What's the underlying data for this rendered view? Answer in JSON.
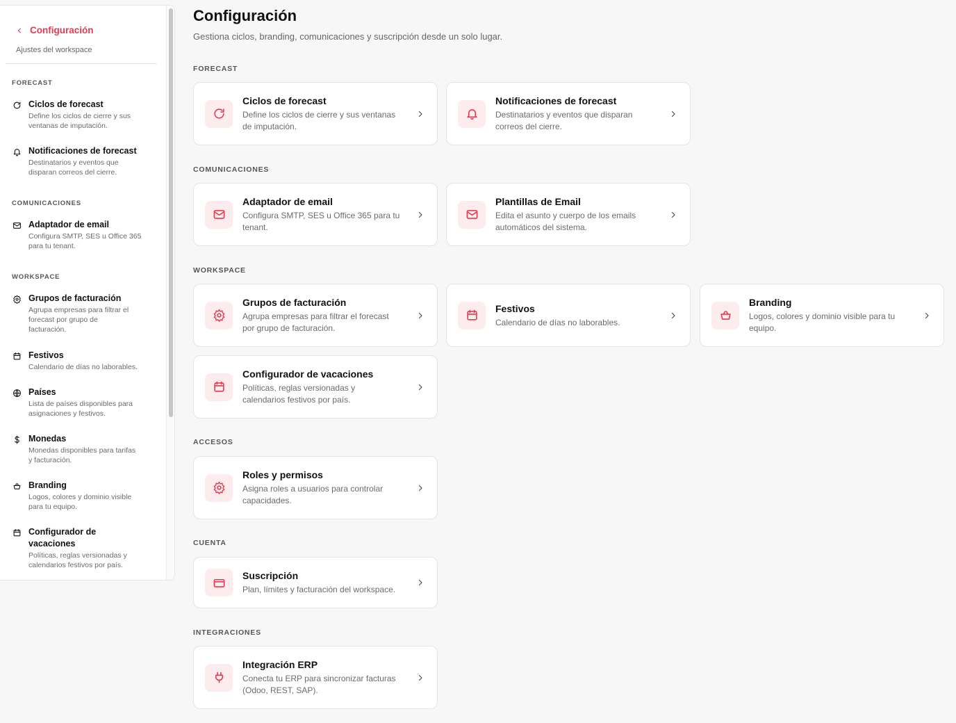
{
  "sidebar": {
    "back_label": "Configuración",
    "subtitle": "Ajustes del workspace",
    "sections": {
      "forecast": "FORECAST",
      "comunicaciones": "COMUNICACIONES",
      "workspace": "WORKSPACE"
    },
    "items": [
      {
        "icon": "refresh-icon",
        "title": "Ciclos de forecast",
        "desc_l1": "Define los ciclos de cierre y sus",
        "desc_l2": "ventanas de imputación."
      },
      {
        "icon": "bell-icon",
        "title": "Notificaciones de forecast",
        "desc_l1": "Destinatarios y eventos que",
        "desc_l2": "disparan correos del cierre."
      },
      {
        "icon": "mail-icon",
        "title": "Adaptador de email",
        "desc_l1": "Configura SMTP, SES u Office 365",
        "desc_l2": "para tu tenant."
      },
      {
        "icon": "gear-icon",
        "title": "Grupos de facturación",
        "desc_l1": "Agrupa empresas para filtrar el",
        "desc_l2": "forecast por grupo de",
        "desc_l3": "facturación."
      },
      {
        "icon": "calendar-icon",
        "title": "Festivos",
        "desc_l1": "Calendario de días no laborables."
      },
      {
        "icon": "globe-icon",
        "title": "Países",
        "desc_l1": "Lista de países disponibles para",
        "desc_l2": "asignaciones y festivos."
      },
      {
        "icon": "dollar-icon",
        "title": "Monedas",
        "desc_l1": "Monedas disponibles para tarifas",
        "desc_l2": "y facturación."
      },
      {
        "icon": "basket-icon",
        "title": "Branding",
        "desc_l1": "Logos, colores y dominio visible",
        "desc_l2": "para tu equipo."
      },
      {
        "icon": "calendar-icon",
        "title_l1": "Configurador de",
        "title_l2": "vacaciones",
        "desc_l1": "Políticas, reglas versionadas y",
        "desc_l2": "calendarios festivos por país."
      }
    ]
  },
  "main": {
    "title": "Configuración",
    "subtitle": "Gestiona ciclos, branding, comunicaciones y suscripción desde un solo lugar.",
    "sections": {
      "forecast": "FORECAST",
      "comunicaciones": "COMUNICACIONES",
      "workspace": "WORKSPACE",
      "accesos": "ACCESOS",
      "cuenta": "CUENTA",
      "integraciones": "INTEGRACIONES"
    },
    "cards": {
      "ciclos": {
        "icon": "refresh-icon",
        "title": "Ciclos de forecast",
        "desc_l1": "Define los ciclos de cierre y sus ventanas",
        "desc_l2": "de imputación."
      },
      "notificaciones": {
        "icon": "bell-icon",
        "title": "Notificaciones de forecast",
        "desc_l1": "Destinatarios y eventos que disparan",
        "desc_l2": "correos del cierre."
      },
      "adaptador": {
        "icon": "mail-icon",
        "title": "Adaptador de email",
        "desc_l1": "Configura SMTP, SES u Office 365 para tu",
        "desc_l2": "tenant."
      },
      "plantillas": {
        "icon": "mail-icon",
        "title": "Plantillas de Email",
        "desc_l1": "Edita el asunto y cuerpo de los emails",
        "desc_l2": "automáticos del sistema."
      },
      "grupos": {
        "icon": "gear-icon",
        "title": "Grupos de facturación",
        "desc_l1": "Agrupa empresas para filtrar el forecast",
        "desc_l2": "por grupo de facturación."
      },
      "festivos": {
        "icon": "calendar-icon",
        "title": "Festivos",
        "desc_l1": "Calendario de días no laborables."
      },
      "branding": {
        "icon": "basket-icon",
        "title": "Branding",
        "desc_l1": "Logos, colores y dominio visible para tu",
        "desc_l2": "equipo."
      },
      "vacaciones": {
        "icon": "calendar-icon",
        "title": "Configurador de vacaciones",
        "desc_l1": "Políticas, reglas versionadas y",
        "desc_l2": "calendarios festivos por país."
      },
      "roles": {
        "icon": "gear-icon",
        "title": "Roles y permisos",
        "desc_l1": "Asigna roles a usuarios para controlar",
        "desc_l2": "capacidades."
      },
      "suscripcion": {
        "icon": "card-icon",
        "title": "Suscripción",
        "desc_l1": "Plan, límites y facturación del workspace."
      },
      "erp": {
        "icon": "plug-icon",
        "title": "Integración ERP",
        "desc_l1": "Conecta tu ERP para sincronizar facturas",
        "desc_l2": "(Odoo, REST, SAP)."
      }
    }
  },
  "colors": {
    "accent": "#e8394f",
    "accent_bg": "#fdecee",
    "page_bg": "#f7f7f8"
  }
}
